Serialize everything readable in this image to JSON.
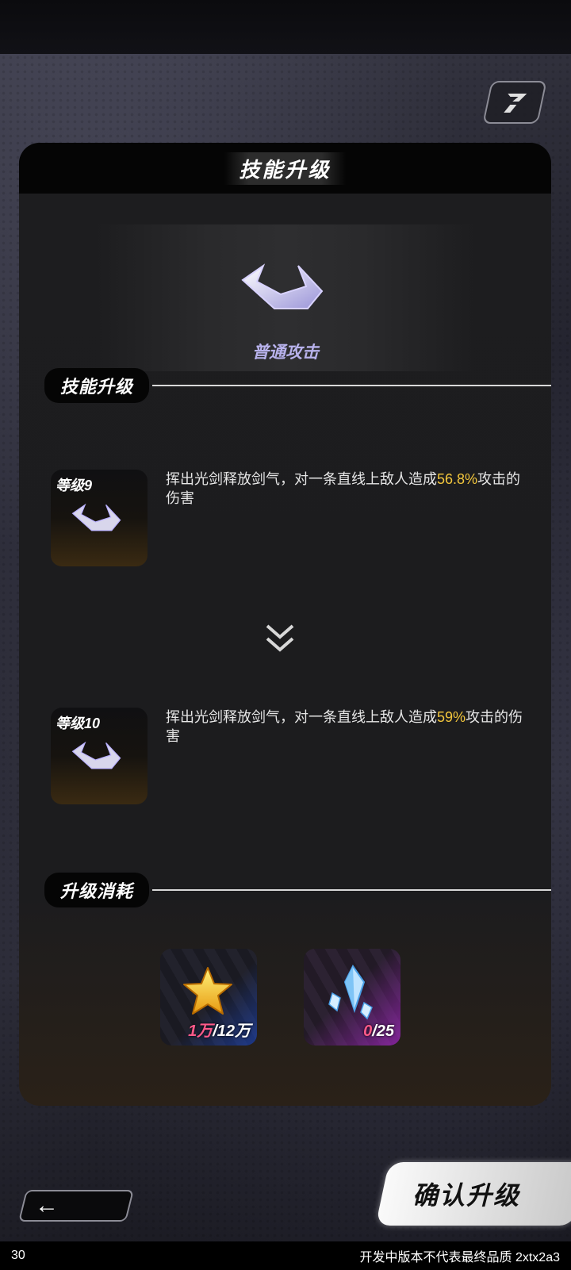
{
  "panel": {
    "title": "技能升级"
  },
  "hero": {
    "skill_name": "普通攻击"
  },
  "upgrade_section": {
    "label": "技能升级"
  },
  "current": {
    "level_tag": "等级9",
    "desc_before": "挥出光剑释放剑气，对一条直线上敌人造成",
    "desc_value": "56.8%",
    "desc_after": "攻击的伤害"
  },
  "next": {
    "level_tag": "等级10",
    "desc_before": "挥出光剑释放剑气，对一条直线上敌人造成",
    "desc_value": "59%",
    "desc_after": "攻击的伤害"
  },
  "cost_section": {
    "label": "升级消耗"
  },
  "costs": [
    {
      "item": "star-coin-icon",
      "have": "1万",
      "need": "/12万"
    },
    {
      "item": "crystal-icon",
      "have": "0",
      "need": "/25"
    }
  ],
  "buttons": {
    "back": "←",
    "confirm": "确认升级"
  },
  "footer": {
    "left": "30",
    "right": "开发中版本不代表最终品质 2xtx2a3"
  },
  "colors": {
    "highlight": "#f2c63c",
    "skill_name": "#b8b2ec",
    "have_count": "#ff5a8a"
  }
}
